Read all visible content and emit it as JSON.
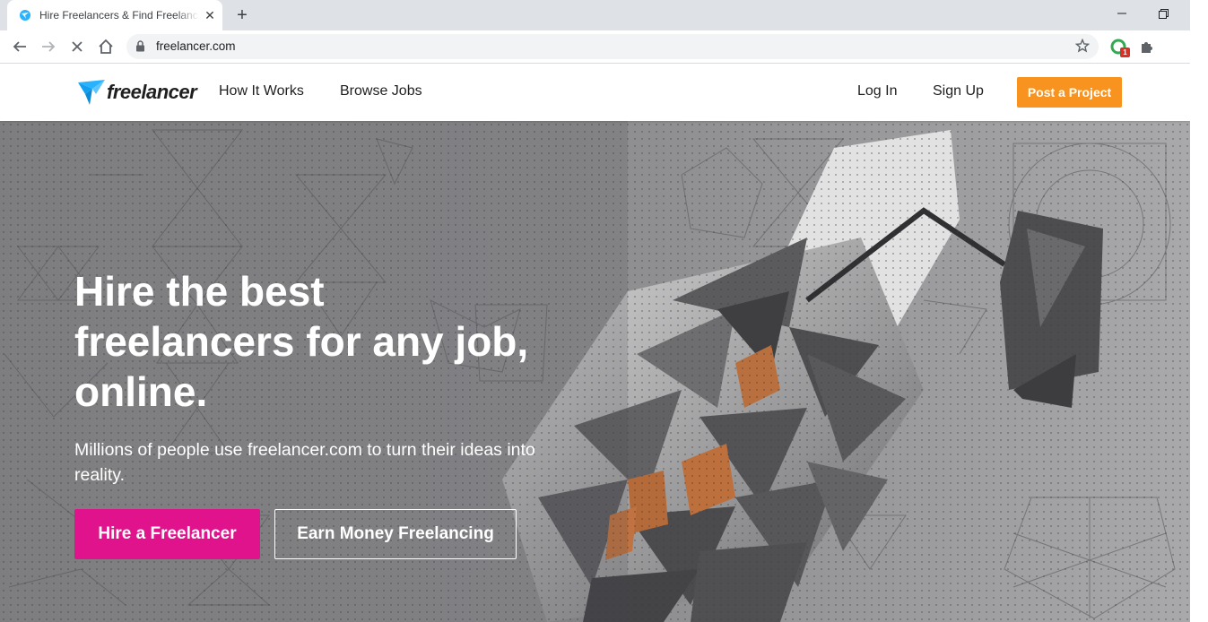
{
  "browser": {
    "tab": {
      "title": "Hire Freelancers & Find Freelance Jobs Online",
      "close": "✕"
    },
    "new_tab": "+",
    "window_controls": {
      "minimize": "—",
      "maximize": "❐",
      "close": "✕"
    },
    "url": "freelancer.com",
    "extension_badge": "1"
  },
  "site": {
    "logo_text": "freelancer",
    "nav": {
      "how_it_works": "How It Works",
      "browse_jobs": "Browse Jobs",
      "log_in": "Log In",
      "sign_up": "Sign Up",
      "post_project": "Post a Project"
    },
    "hero": {
      "title_line1": "Hire the best",
      "title_line2": "freelancers for any job,",
      "title_line3": "online.",
      "subtitle": "Millions of people use freelancer.com to turn their ideas into reality.",
      "cta_primary": "Hire a Freelancer",
      "cta_secondary": "Earn Money Freelancing"
    }
  },
  "colors": {
    "brand_blue": "#29b2fe",
    "post_orange": "#f7931e",
    "hire_pink": "#e0138c",
    "hero_gray": "#8d8d8f"
  }
}
